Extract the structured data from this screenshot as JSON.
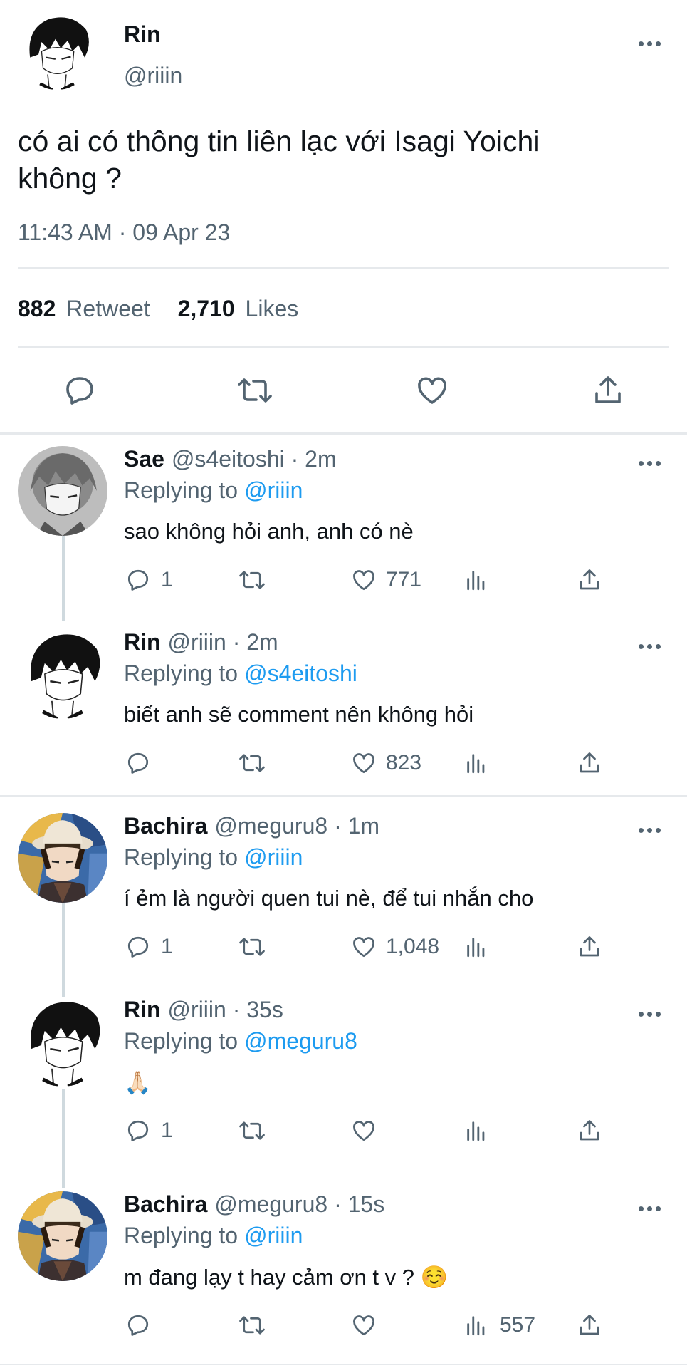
{
  "main_tweet": {
    "name": "Rin",
    "handle": "@riiin",
    "text_line1": "có ai có thông tin liên lạc với Isagi Yoichi",
    "text_line2": "không ?",
    "timestamp": "11:43 AM · 09 Apr 23",
    "retweets": "882",
    "retweets_label": "Retweet",
    "likes": "2,710",
    "likes_label": "Likes"
  },
  "replies": [
    {
      "name": "Sae",
      "meta": "@s4eitoshi · 2m",
      "replying_prefix": "Replying to",
      "replying_to": "@riiin",
      "text": "sao không hỏi anh, anh có nè",
      "replies": "1",
      "likes": "771",
      "views": "",
      "avatar": "sae"
    },
    {
      "name": "Rin",
      "meta": "@riiin · 2m",
      "replying_prefix": "Replying to",
      "replying_to": "@s4eitoshi",
      "text": "biết anh sẽ comment nên không hỏi",
      "replies": "",
      "likes": "823",
      "views": "",
      "avatar": "rin"
    },
    {
      "name": "Bachira",
      "meta": "@meguru8 · 1m",
      "replying_prefix": "Replying to",
      "replying_to": "@riiin",
      "text": "í ẻm là người quen tui nè, để tui nhắn cho",
      "replies": "1",
      "likes": "1,048",
      "views": "",
      "avatar": "bachira"
    },
    {
      "name": "Rin",
      "meta": "@riiin · 35s",
      "replying_prefix": "Replying to",
      "replying_to": "@meguru8",
      "text": "🙏🏻",
      "replies": "1",
      "likes": "",
      "views": "",
      "avatar": "rin"
    },
    {
      "name": "Bachira",
      "meta": "@meguru8 · 15s",
      "replying_prefix": "Replying to",
      "replying_to": "@riiin",
      "text": "m đang lạy t hay cảm ơn t v ? ☺️",
      "replies": "",
      "likes": "",
      "views": "557",
      "avatar": "bachira"
    }
  ],
  "icons": {
    "reply": "speech-bubble-icon",
    "retweet": "retweet-arrows-icon",
    "like": "heart-icon",
    "views": "bar-chart-icon",
    "share": "upload-arrow-icon",
    "more": "more-dots-icon"
  },
  "colors": {
    "link": "#1d9bf0",
    "secondary": "#536471",
    "text": "#0f1419"
  }
}
